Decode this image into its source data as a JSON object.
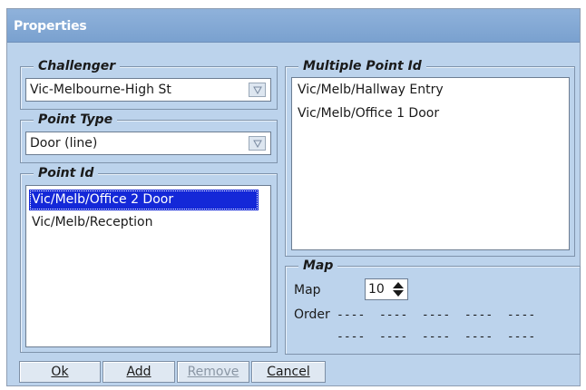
{
  "window": {
    "title": "Properties"
  },
  "challenger": {
    "legend": "Challenger",
    "selected": "Vic-Melbourne-High St"
  },
  "point_type": {
    "legend": "Point Type",
    "selected": "Door (line)"
  },
  "point_id": {
    "legend": "Point Id",
    "items": [
      "Vic/Melb/Office 2 Door",
      "Vic/Melb/Reception"
    ],
    "selected_index": 0
  },
  "multiple_point_id": {
    "legend": "Multiple Point Id",
    "items": [
      "Vic/Melb/Hallway Entry",
      "Vic/Melb/Office 1 Door"
    ]
  },
  "map": {
    "legend": "Map",
    "map_label": "Map",
    "map_value": "10",
    "order_label": "Order",
    "order_row1": "----  ----  ----  ----  ----",
    "order_row2": "----  ----  ----  ----  ----"
  },
  "buttons": {
    "ok": "Ok",
    "add": "Add",
    "remove": "Remove",
    "cancel": "Cancel"
  },
  "icons": {
    "combo_arrow": "triangle-down-icon",
    "spin_up": "triangle-up-icon",
    "spin_down": "triangle-down-icon"
  }
}
